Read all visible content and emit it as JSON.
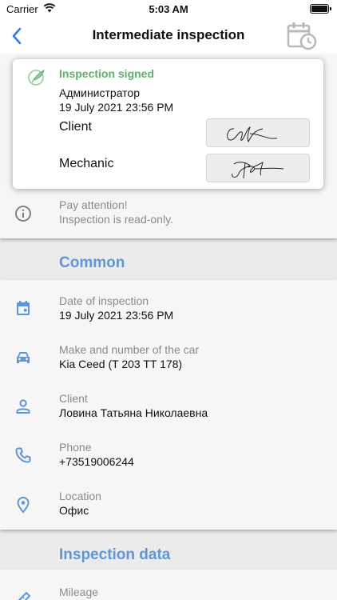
{
  "status_bar": {
    "carrier": "Carrier",
    "time": "5:03 AM"
  },
  "nav": {
    "title": "Intermediate inspection"
  },
  "signature": {
    "status": "Inspection signed",
    "author": "Администратор",
    "date": "19 July 2021 23:56 PM",
    "client_label": "Client",
    "mechanic_label": "Mechanic"
  },
  "notice": {
    "line1": "Pay attention!",
    "line2": "Inspection is read-only."
  },
  "sections": {
    "common": "Common",
    "inspection_data": "Inspection data"
  },
  "common_rows": [
    {
      "icon": "calendar-icon",
      "label": "Date of inspection",
      "value": "19 July 2021 23:56 PM"
    },
    {
      "icon": "car-icon",
      "label": "Make and number of the car",
      "value": "Kia Ceed (T 203 TT 178)"
    },
    {
      "icon": "person-icon",
      "label": "Client",
      "value": "Ловина Татьяна Николаевна"
    },
    {
      "icon": "phone-icon",
      "label": "Phone",
      "value": "+73519006244"
    },
    {
      "icon": "location-icon",
      "label": "Location",
      "value": "Офис"
    }
  ],
  "data_rows": [
    {
      "icon": "ruler-icon",
      "label": "Mileage"
    }
  ],
  "colors": {
    "accent": "#5e96d8",
    "signed": "#5db06a",
    "muted": "#8a8a8a"
  }
}
